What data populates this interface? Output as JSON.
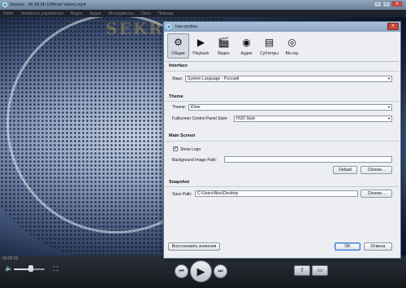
{
  "player": {
    "title": "Senoro - MI MI MI (Official Video).mp4",
    "menu": [
      "Файл",
      "Элементы управления",
      "Видео",
      "Аудио",
      "Инструменты",
      "Окно",
      "Помощь"
    ],
    "watermark": "SEKRENTS.ORG",
    "timecode": "00:02:03",
    "volume_level": 0.62,
    "window_buttons": {
      "minimize": "–",
      "maximize": "□",
      "close": "✕"
    },
    "controls": {
      "prev": "⏮",
      "play": "▶",
      "next": "⏭",
      "share": "⇪",
      "folder": "▭",
      "volume": "🔈",
      "fullscreen": "⛶"
    }
  },
  "dialog": {
    "title": "Настройки",
    "close": "✕",
    "tabs": [
      {
        "label": "Общие",
        "icon": "gear-icon",
        "glyph": "⚙",
        "active": true
      },
      {
        "label": "Playback",
        "icon": "video-camera-icon",
        "glyph": "▶",
        "active": false
      },
      {
        "label": "Видео",
        "icon": "clapperboard-icon",
        "glyph": "🎬",
        "active": false
      },
      {
        "label": "Аудио",
        "icon": "speaker-icon",
        "glyph": "◉",
        "active": false
      },
      {
        "label": "Субтитры",
        "icon": "subtitles-icon",
        "glyph": "▤",
        "active": false
      },
      {
        "label": "Blu-ray",
        "icon": "bluray-icon",
        "glyph": "◎",
        "active": false
      }
    ],
    "interface": {
      "title": "Interface",
      "language_label": "Язык:",
      "language_value": "System Language - Русский"
    },
    "theme": {
      "title": "Theme",
      "theme_label": "Theme:",
      "theme_value": "iDeer",
      "fullscreen_label": "Fullscreen Control Panel Style:",
      "fullscreen_value": "HUD Style"
    },
    "main_screen": {
      "title": "Main Screen",
      "show_logo_label": "Show Logo",
      "show_logo_checked": true,
      "bg_image_label": "Background Image Path:",
      "bg_image_value": "",
      "default_button": "Default",
      "choose_button": "Choose..."
    },
    "snapshot": {
      "title": "Snapshot",
      "save_path_label": "Save Path:",
      "save_path_value": "C:\\Users\\Alex\\Desktop",
      "choose_button": "Choose..."
    },
    "footer": {
      "restore_button": "Восстановить значения",
      "ok_button": "OK",
      "cancel_button": "Отмена"
    }
  }
}
